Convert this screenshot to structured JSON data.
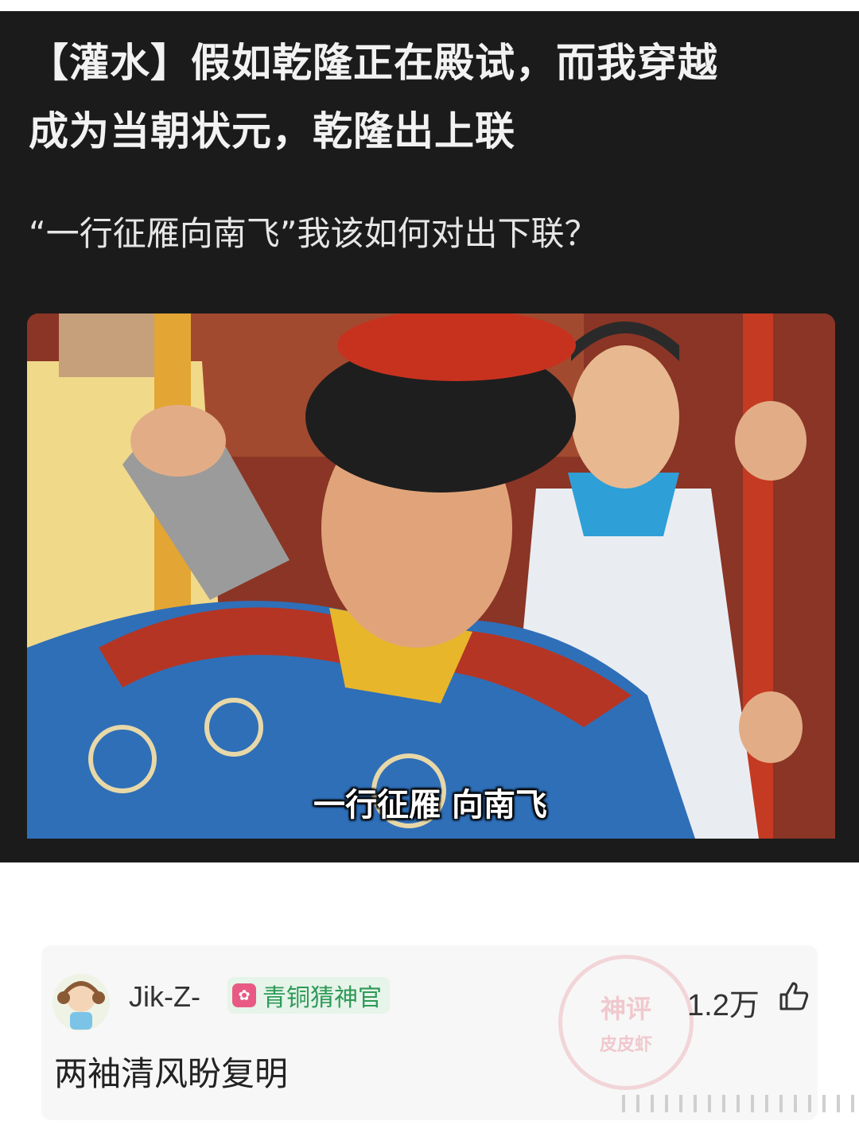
{
  "post": {
    "title_line1": "【灌水】假如乾隆正在殿试，而我穿越",
    "title_line2": "成为当朝状元，乾隆出上联",
    "subtitle": "“一行征雁向南飞”我该如何对出下联？",
    "image_caption": "一行征雁 向南飞"
  },
  "comment": {
    "username": "Jik-Z-",
    "badge_label": "青铜猜神官",
    "like_count": "1.2万",
    "text": "两袖清风盼复明",
    "watermark_line1": "神评",
    "watermark_line2": "皮皮虾",
    "icons": [
      "avatar",
      "badge-icon",
      "thumbs-up-icon"
    ]
  }
}
